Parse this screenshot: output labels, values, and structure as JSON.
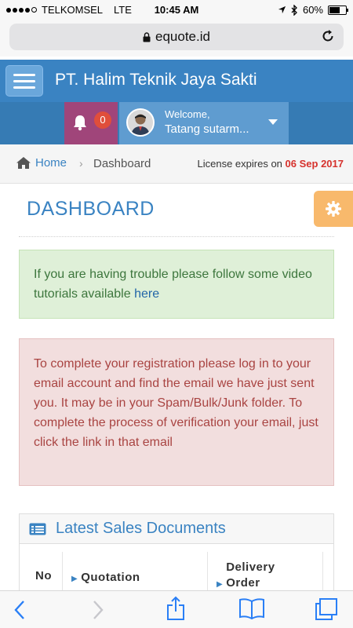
{
  "status_bar": {
    "carrier": "TELKOMSEL",
    "network": "LTE",
    "time": "10:45 AM",
    "battery": "60%",
    "battery_level": 0.6
  },
  "browser": {
    "url": "equote.id"
  },
  "header": {
    "app_title": "PT. Halim Teknik Jaya Sakti",
    "notification_count": "0",
    "welcome_label": "Welcome,",
    "user_name": "Tatang sutarm..."
  },
  "breadcrumb": {
    "home": "Home",
    "current": "Dashboard",
    "license_prefix": "License expires on",
    "license_date": "06 Sep 2017"
  },
  "page": {
    "title": "DASHBOARD",
    "success_text": "If you are having trouble please follow some video tutorials available",
    "success_link": "here",
    "danger_text": "To complete your registration please log in to your email account and find the email we have just sent you. It may be in your Spam/Bulk/Junk folder. To complete the process of verification your email, just click the link in that email"
  },
  "widget": {
    "title": "Latest Sales Documents",
    "columns": [
      "No",
      "Quotation",
      "Delivery Order"
    ]
  },
  "colors": {
    "brand_blue": "#3a83c2",
    "notification_bg": "#a0457a",
    "settings_orange": "#f8b96c",
    "license_red": "#d6322d"
  }
}
